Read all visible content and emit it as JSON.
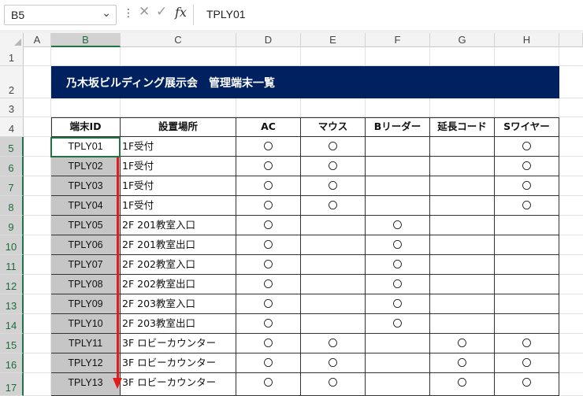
{
  "formula_bar": {
    "name_box": "B5",
    "dots": "⋮",
    "cancel": "✕",
    "enter": "✓",
    "fx": "fx",
    "value": "TPLY01"
  },
  "columns": [
    "A",
    "B",
    "C",
    "D",
    "E",
    "F",
    "G",
    "H"
  ],
  "selected_column": "B",
  "rows": [
    "1",
    "2",
    "3",
    "4",
    "5",
    "6",
    "7",
    "8",
    "9",
    "10",
    "11",
    "12",
    "13",
    "14",
    "15",
    "16",
    "17"
  ],
  "title": "乃木坂ビルディング展示会　管理端末一覧",
  "table": {
    "headers": [
      "端末ID",
      "設置場所",
      "AC",
      "マウス",
      "Bリーダー",
      "延長コード",
      "Sワイヤー"
    ],
    "rows": [
      {
        "id": "TPLY01",
        "loc": "1F受付",
        "marks": [
          "〇",
          "〇",
          "",
          "",
          "〇"
        ]
      },
      {
        "id": "TPLY02",
        "loc": "1F受付",
        "marks": [
          "〇",
          "〇",
          "",
          "",
          "〇"
        ]
      },
      {
        "id": "TPLY03",
        "loc": "1F受付",
        "marks": [
          "〇",
          "〇",
          "",
          "",
          "〇"
        ]
      },
      {
        "id": "TPLY04",
        "loc": "1F受付",
        "marks": [
          "〇",
          "〇",
          "",
          "",
          "〇"
        ]
      },
      {
        "id": "TPLY05",
        "loc": "2F 201教室入口",
        "marks": [
          "〇",
          "",
          "〇",
          "",
          ""
        ]
      },
      {
        "id": "TPLY06",
        "loc": "2F 201教室出口",
        "marks": [
          "〇",
          "",
          "〇",
          "",
          ""
        ]
      },
      {
        "id": "TPLY07",
        "loc": "2F 202教室入口",
        "marks": [
          "〇",
          "",
          "〇",
          "",
          ""
        ]
      },
      {
        "id": "TPLY08",
        "loc": "2F 202教室出口",
        "marks": [
          "〇",
          "",
          "〇",
          "",
          ""
        ]
      },
      {
        "id": "TPLY09",
        "loc": "2F 203教室入口",
        "marks": [
          "〇",
          "",
          "〇",
          "",
          ""
        ]
      },
      {
        "id": "TPLY10",
        "loc": "2F 203教室出口",
        "marks": [
          "〇",
          "",
          "〇",
          "",
          ""
        ]
      },
      {
        "id": "TPLY11",
        "loc": "3F ロビーカウンター",
        "marks": [
          "〇",
          "〇",
          "",
          "〇",
          "〇"
        ]
      },
      {
        "id": "TPLY12",
        "loc": "3F ロビーカウンター",
        "marks": [
          "〇",
          "〇",
          "",
          "〇",
          "〇"
        ]
      },
      {
        "id": "TPLY13",
        "loc": "3F ロビーカウンター",
        "marks": [
          "〇",
          "〇",
          "",
          "〇",
          "〇"
        ]
      }
    ]
  },
  "colors": {
    "banner": "#002160",
    "selection": "#217346",
    "fill_gray": "#c6c6c6",
    "arrow": "#e31b1b"
  }
}
